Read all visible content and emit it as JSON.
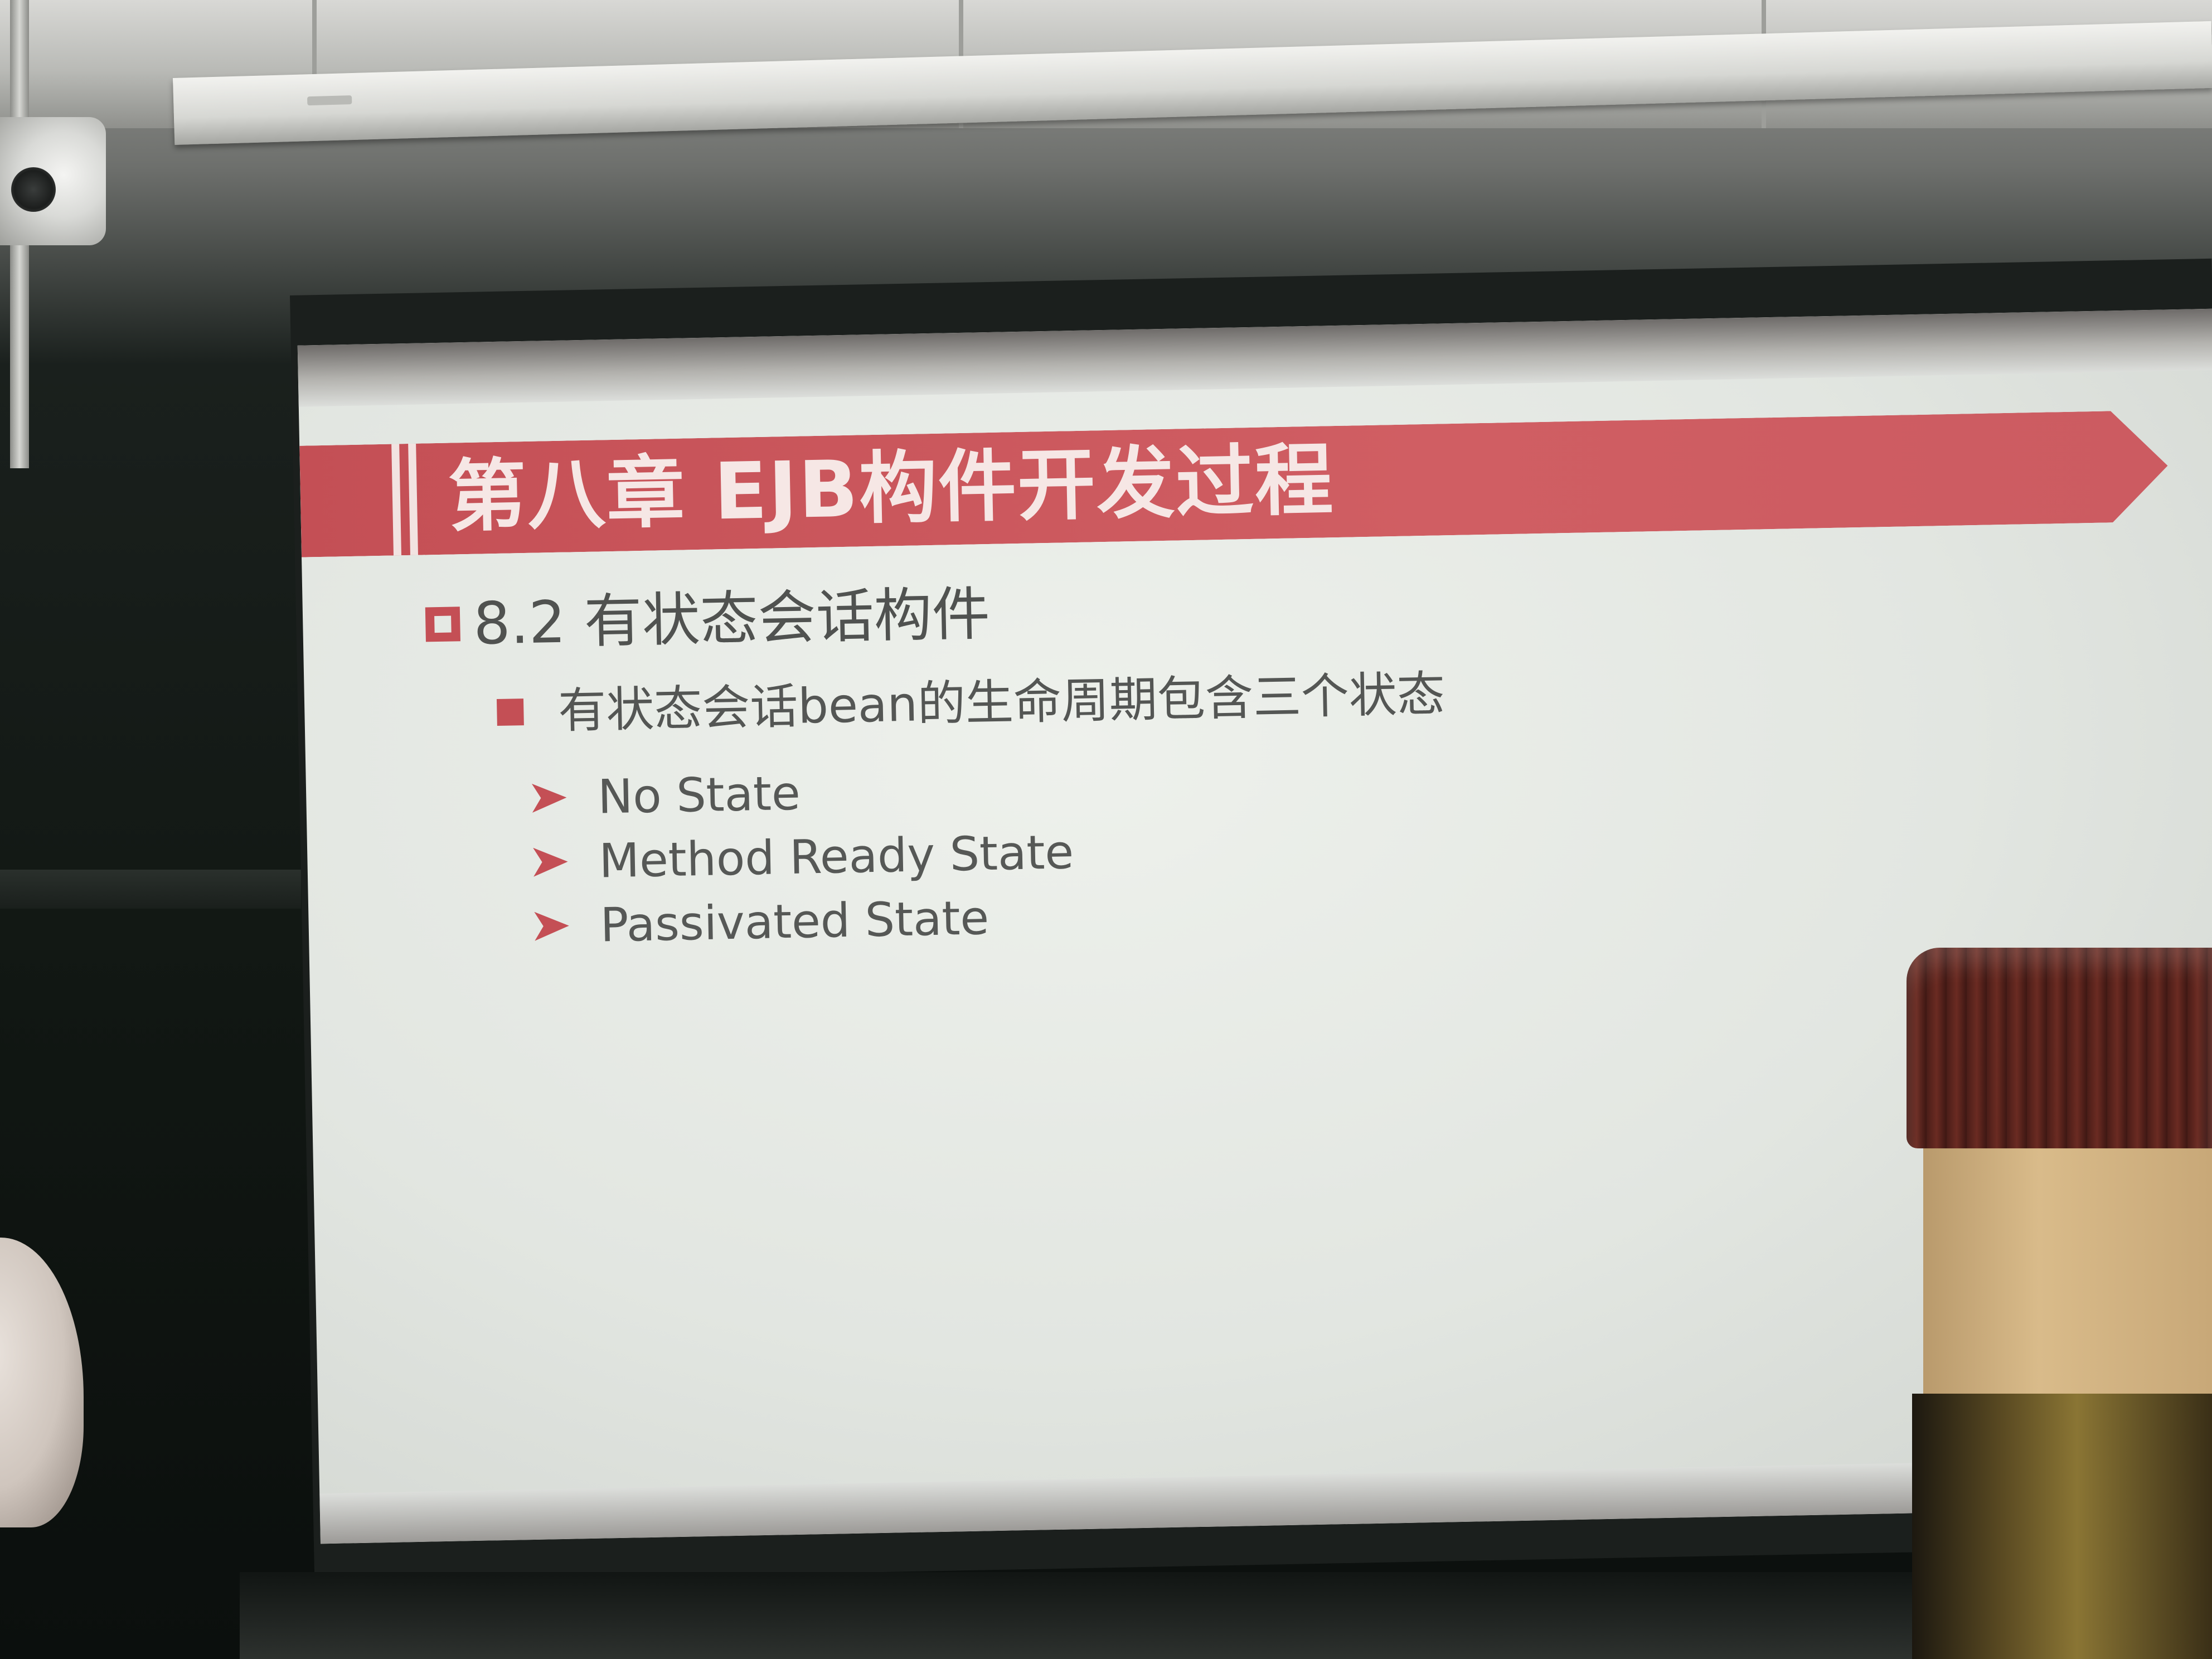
{
  "slide": {
    "title": "第八章 EJB构件开发过程",
    "section": "8.2 有状态会话构件",
    "bullet": "有状态会话bean的生命周期包含三个状态",
    "states": [
      "No State",
      "Method Ready State",
      "Passivated State"
    ]
  },
  "colors": {
    "accent": "#c44f55",
    "slide_background": "#e6eae5",
    "text": "#505250"
  },
  "icons": {
    "section_marker": "hollow-square-icon",
    "bullet_marker": "filled-square-icon",
    "sub_bullet_marker": "arrow-bullet-icon"
  }
}
